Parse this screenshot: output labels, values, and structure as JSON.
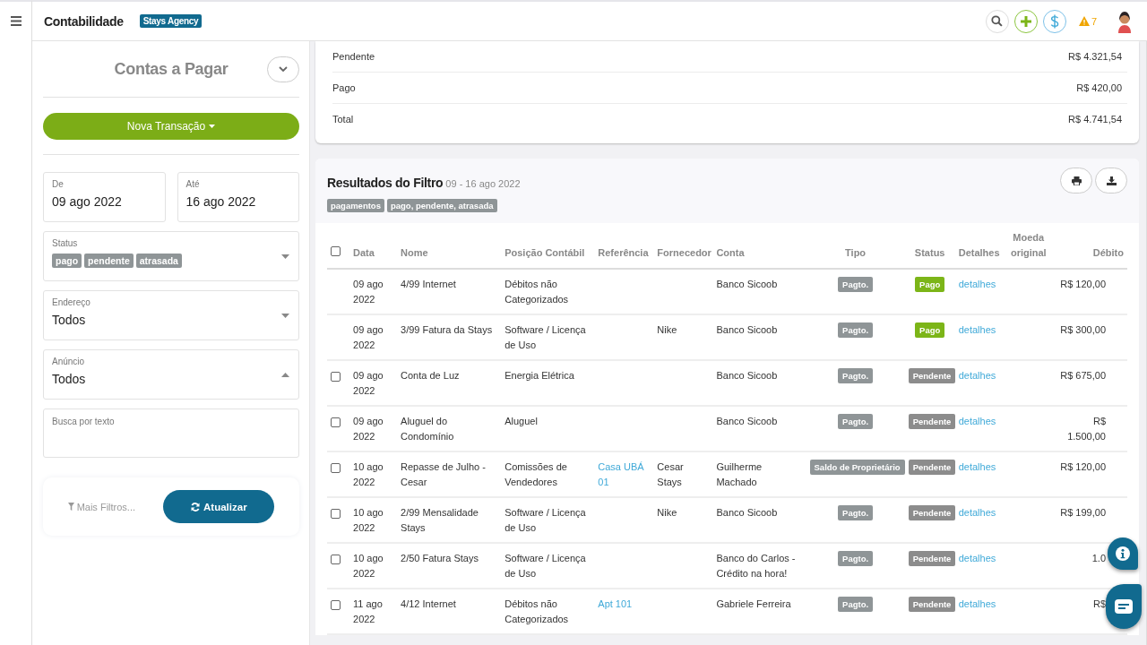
{
  "header": {
    "title": "Contabilidade",
    "badge": "Stays Agency",
    "alert_count": "7"
  },
  "sidebar": {
    "title": "Contas a Pagar",
    "new_button": "Nova Transação",
    "date_from": {
      "label": "De",
      "value": "09 ago 2022"
    },
    "date_to": {
      "label": "Até",
      "value": "16 ago 2022"
    },
    "status_filter": {
      "label": "Status",
      "tags": [
        "pago",
        "pendente",
        "atrasada"
      ],
      "expanded": false
    },
    "address_filter": {
      "label": "Endereço",
      "value": "Todos",
      "expanded": false
    },
    "listing_filter": {
      "label": "Anúncio",
      "value": "Todos",
      "expanded": true
    },
    "text_search": {
      "placeholder": "Busca por texto"
    },
    "more_filters": "Mais Filtros...",
    "refresh_button": "Atualizar"
  },
  "summary": [
    {
      "label": "Pendente",
      "value": "R$ 4.321,54"
    },
    {
      "label": "Pago",
      "value": "R$ 420,00"
    },
    {
      "label": "Total",
      "value": "R$ 4.741,54"
    }
  ],
  "results": {
    "title": "Resultados do Filtro",
    "range": "09 - 16 ago 2022",
    "tags": [
      "pagamentos",
      "pago, pendente, atrasada"
    ],
    "select_all": {
      "checked": false
    },
    "columns": [
      "Data",
      "Nome",
      "Posição Contábil",
      "Referência",
      "Fornecedor",
      "Conta",
      "Tipo",
      "Status",
      "Detalhes",
      "Moeda original",
      "Débito"
    ],
    "rows": [
      {
        "date": "09 ago 2022",
        "name": "4/99 Internet",
        "account_position": "Débitos não Categorizados",
        "account": "Banco Sicoob",
        "type": "Pagto.",
        "status": {
          "label": "Pago",
          "color": "#7cb518"
        },
        "details": "detalhes",
        "debit": "R$ 120,00"
      },
      {
        "date": "09 ago 2022",
        "name": "3/99 Fatura da Stays",
        "account_position": "Software / Licença de Uso",
        "supplier": "Nike",
        "account": "Banco Sicoob",
        "type": "Pagto.",
        "status": {
          "label": "Pago",
          "color": "#7cb518"
        },
        "details": "detalhes",
        "debit": "R$ 300,00"
      },
      {
        "checkbox": {
          "checked": false
        },
        "date": "09 ago 2022",
        "name": "Conta de Luz",
        "account_position": "Energia Elétrica",
        "account": "Banco Sicoob",
        "type": "Pagto.",
        "status": {
          "label": "Pendente",
          "color": "#8c8c8c"
        },
        "details": "detalhes",
        "debit": "R$ 675,00"
      },
      {
        "checkbox": {
          "checked": false
        },
        "date": "09 ago 2022",
        "name": "Aluguel do Condomínio",
        "account_position": "Aluguel",
        "account": "Banco Sicoob",
        "type": "Pagto.",
        "status": {
          "label": "Pendente",
          "color": "#8c8c8c"
        },
        "details": "detalhes",
        "debit": "R$ 1.500,00"
      },
      {
        "checkbox": {
          "checked": false
        },
        "date": "10 ago 2022",
        "name": "Repasse de Julho - Cesar",
        "account_position": "Comissões de Vendedores",
        "reference": "Casa UBÁ 01",
        "supplier": "Cesar Stays",
        "account": "Guilherme Machado",
        "type": "Saldo de Proprietário",
        "status": {
          "label": "Pendente",
          "color": "#8c8c8c"
        },
        "details": "detalhes",
        "debit": "R$ 120,00"
      },
      {
        "checkbox": {
          "checked": false
        },
        "date": "10 ago 2022",
        "name": "2/99 Mensalidade Stays",
        "account_position": "Software / Licença de Uso",
        "supplier": "Nike",
        "account": "Banco Sicoob",
        "type": "Pagto.",
        "status": {
          "label": "Pendente",
          "color": "#8c8c8c"
        },
        "details": "detalhes",
        "debit": "R$ 199,00"
      },
      {
        "checkbox": {
          "checked": false
        },
        "date": "10 ago 2022",
        "name": "2/50 Fatura Stays",
        "account_position": "Software / Licença de Uso",
        "account": "Banco do Carlos - Crédito na hora!",
        "type": "Pagto.",
        "status": {
          "label": "Pendente",
          "color": "#8c8c8c"
        },
        "details": "detalhes",
        "debit": "1.0"
      },
      {
        "checkbox": {
          "checked": false
        },
        "date": "11 ago 2022",
        "name": "4/12 Internet",
        "account_position": "Débitos não Categorizados",
        "reference": "Apt 101",
        "account": "Gabriele Ferreira",
        "type": "Pagto.",
        "status": {
          "label": "Pendente",
          "color": "#8c8c8c"
        },
        "details": "detalhes",
        "debit": "R$"
      }
    ]
  }
}
